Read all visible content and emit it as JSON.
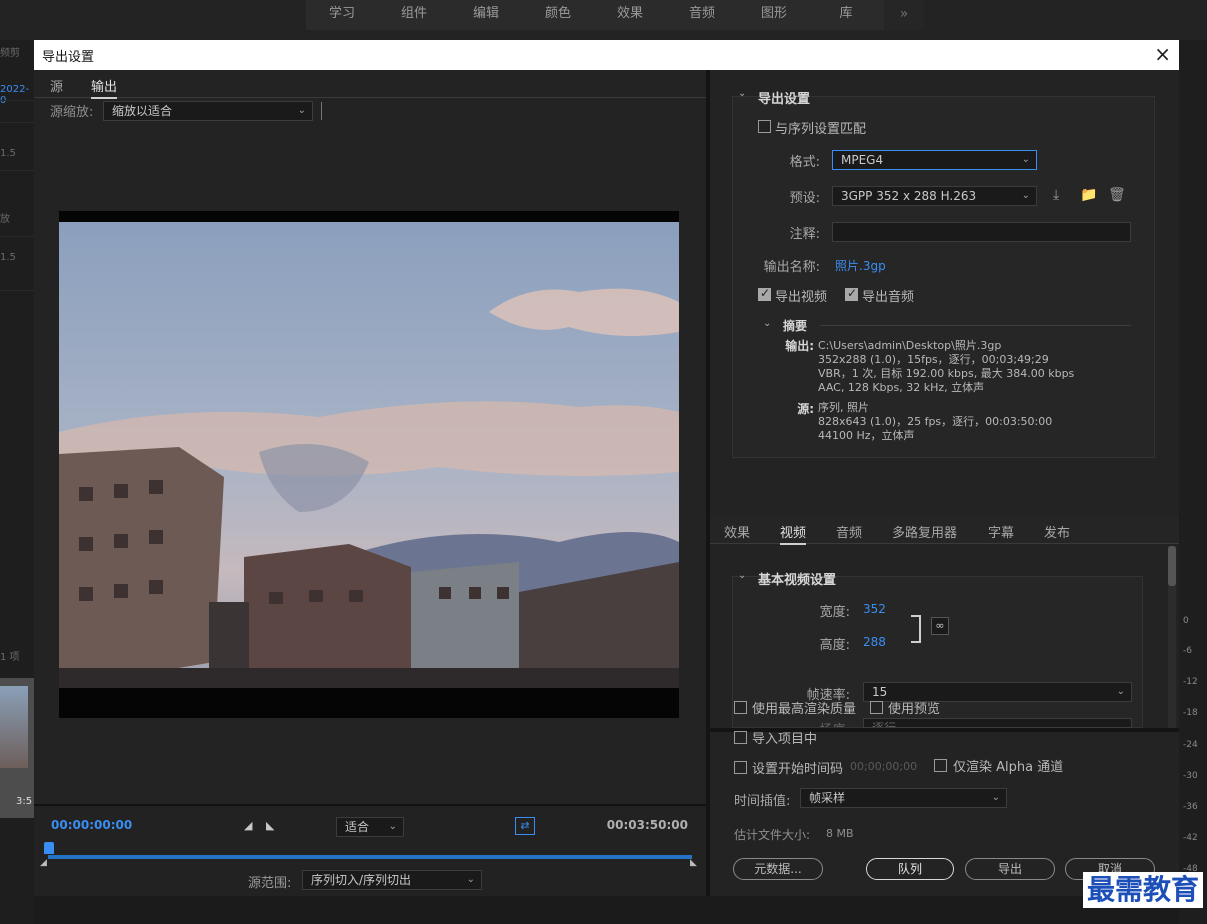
{
  "workspace": {
    "tabs": [
      "学习",
      "组件",
      "编辑",
      "颜色",
      "效果",
      "音频",
      "图形",
      "库"
    ],
    "more": "»"
  },
  "background": {
    "left_texts": [
      "频剪",
      "2022-0",
      "1.5",
      "放",
      "1.5",
      "1 项",
      "3:5"
    ],
    "meter_labels": [
      "0",
      "-6",
      "-12",
      "-18",
      "-24",
      "-30",
      "-36",
      "-42",
      "-48"
    ]
  },
  "dialog": {
    "title": "导出设置",
    "close": "×"
  },
  "left": {
    "tabs": [
      "源",
      "输出"
    ],
    "active_tab": "输出",
    "scale_label": "源缩放:",
    "scale_value": "缩放以适合",
    "timecode_start": "00:00:00:00",
    "timecode_end": "00:03:50:00",
    "fit_value": "适合",
    "range_label": "源范围:",
    "range_value": "序列切入/序列切出",
    "progress": 0
  },
  "export": {
    "section_title": "导出设置",
    "match_sequence": "与序列设置匹配",
    "format_label": "格式:",
    "format_value": "MPEG4",
    "preset_label": "预设:",
    "preset_value": "3GPP 352 x 288 H.263",
    "comment_label": "注释:",
    "comment_value": "",
    "output_name_label": "输出名称:",
    "output_name_value": "照片.3gp",
    "export_video": "导出视频",
    "export_audio": "导出音频",
    "summary_title": "摘要",
    "summary_output_key": "输出:",
    "summary_output_lines": [
      "C:\\Users\\admin\\Desktop\\照片.3gp",
      "352x288 (1.0)，15fps，逐行，00;03;49;29",
      "VBR，1 次, 目标 192.00 kbps, 最大 384.00 kbps",
      "AAC, 128 Kbps, 32  kHz, 立体声"
    ],
    "summary_source_key": "源:",
    "summary_source_lines": [
      "序列, 照片",
      "828x643 (1.0)，25 fps，逐行，00:03:50:00",
      "44100 Hz，立体声"
    ]
  },
  "settings_tabs": [
    "效果",
    "视频",
    "音频",
    "多路复用器",
    "字幕",
    "发布"
  ],
  "settings_active_tab": "视频",
  "video": {
    "section_title": "基本视频设置",
    "width_label": "宽度:",
    "width_value": "352",
    "height_label": "高度:",
    "height_value": "288",
    "framerate_label": "帧速率:",
    "framerate_value": "15",
    "cut_label": "场序:",
    "cut_value": "逐行"
  },
  "bottom": {
    "max_render": "使用最高渲染质量",
    "use_preview": "使用预览",
    "import_project": "导入项目中",
    "set_start_tc": "设置开始时间码",
    "start_tc_value": "00;00;00;00",
    "alpha_only": "仅渲染 Alpha 通道",
    "interp_label": "时间插值:",
    "interp_value": "帧采样",
    "filesize_label": "估计文件大小:",
    "filesize_value": "8 MB",
    "metadata_btn": "元数据...",
    "queue_btn": "队列",
    "export_btn": "导出",
    "cancel_btn": "取消"
  },
  "watermark": "最需教育",
  "colors": {
    "accent": "#3a8ef2",
    "panel": "#232323",
    "title_bg": "#ffffff"
  }
}
